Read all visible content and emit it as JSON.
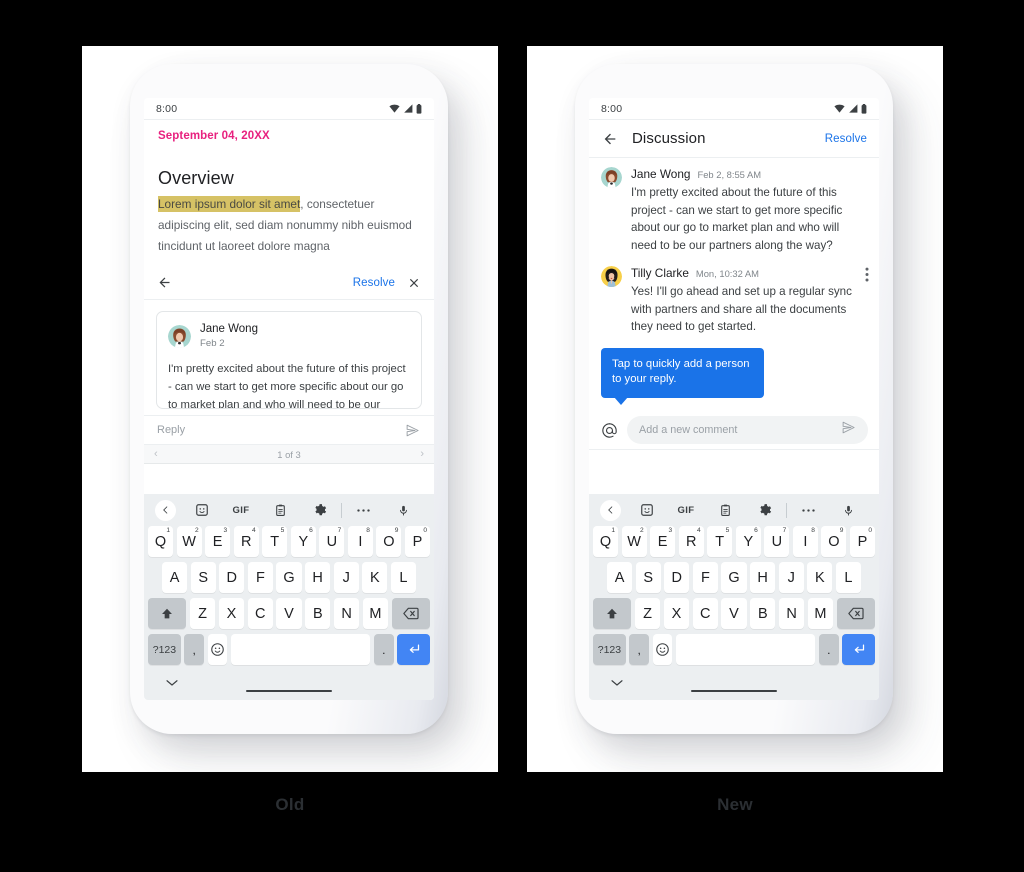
{
  "background_color": "#000000",
  "accent_blue": "#1a73e8",
  "accent_pink": "#e8217f",
  "highlight_gold": "#d6c265",
  "panels": {
    "left_caption": "Old",
    "right_caption": "New"
  },
  "status_bar": {
    "time": "8:00",
    "icons": [
      "wifi-icon",
      "signal-icon",
      "battery-icon"
    ]
  },
  "old": {
    "document": {
      "date": "September 04, 20XX",
      "title": "Overview",
      "highlighted_text": "Lorem ipsum dolor sit amet",
      "body_rest": ", consectetuer adipiscing elit, sed diam nonummy nibh euismod tincidunt ut laoreet dolore magna"
    },
    "sheet_bar": {
      "back_icon": "arrow-left-icon",
      "resolve_label": "Resolve",
      "close_icon": "close-icon"
    },
    "comment": {
      "author": "Jane Wong",
      "date": "Feb 2",
      "text": "I'm pretty excited about the future of this project - can we start to get more specific about our go to market plan and who will need to be our partners"
    },
    "reply": {
      "placeholder": "Reply",
      "send_icon": "send-icon"
    },
    "pager": {
      "prev_icon": "chevron-left-icon",
      "count": "1 of 3",
      "next_icon": "chevron-right-icon"
    }
  },
  "new": {
    "app_bar": {
      "back_icon": "arrow-left-icon",
      "title": "Discussion",
      "resolve_label": "Resolve"
    },
    "messages": [
      {
        "author": "Jane Wong",
        "time": "Feb 2, 8:55 AM",
        "text": "I'm pretty excited about the future of this project - can we start to get more specific about our go to market plan and who will need to be our partners along the way?",
        "avatar_bg": "#a7d6cf",
        "has_kebab": false
      },
      {
        "author": "Tilly Clarke",
        "time": "Mon, 10:32 AM",
        "text": "Yes! I'll go ahead and set up a regular sync with partners and share all the documents they need to get started.",
        "avatar_bg": "#f7cf49",
        "has_kebab": true
      }
    ],
    "tooltip": {
      "text": "Tap to quickly add a person to your reply.",
      "color": "#1a73e8"
    },
    "composer": {
      "mention_icon": "at-mention-icon",
      "placeholder": "Add a new comment",
      "send_icon": "send-icon"
    }
  },
  "keyboard": {
    "toolbar": [
      "chevron-left-icon",
      "sticker-face-icon",
      "gif-icon",
      "clipboard-icon",
      "gear-icon",
      "divider",
      "more-dots-icon",
      "microphone-icon"
    ],
    "gif_label": "GIF",
    "row1": [
      {
        "key": "Q",
        "num": "1"
      },
      {
        "key": "W",
        "num": "2"
      },
      {
        "key": "E",
        "num": "3"
      },
      {
        "key": "R",
        "num": "4"
      },
      {
        "key": "T",
        "num": "5"
      },
      {
        "key": "Y",
        "num": "6"
      },
      {
        "key": "U",
        "num": "7"
      },
      {
        "key": "I",
        "num": "8"
      },
      {
        "key": "O",
        "num": "9"
      },
      {
        "key": "P",
        "num": "0"
      }
    ],
    "row2": [
      "A",
      "S",
      "D",
      "F",
      "G",
      "H",
      "J",
      "K",
      "L"
    ],
    "row3": [
      "Z",
      "X",
      "C",
      "V",
      "B",
      "N",
      "M"
    ],
    "shift_icon": "shift-up-icon",
    "backspace_icon": "backspace-icon",
    "symbols_label": "?123",
    "comma_label": ",",
    "emoji_icon": "emoji-smile-icon",
    "space_label": "",
    "period_label": ".",
    "enter_icon": "enter-return-icon",
    "hide_icon": "chevron-down-icon"
  }
}
